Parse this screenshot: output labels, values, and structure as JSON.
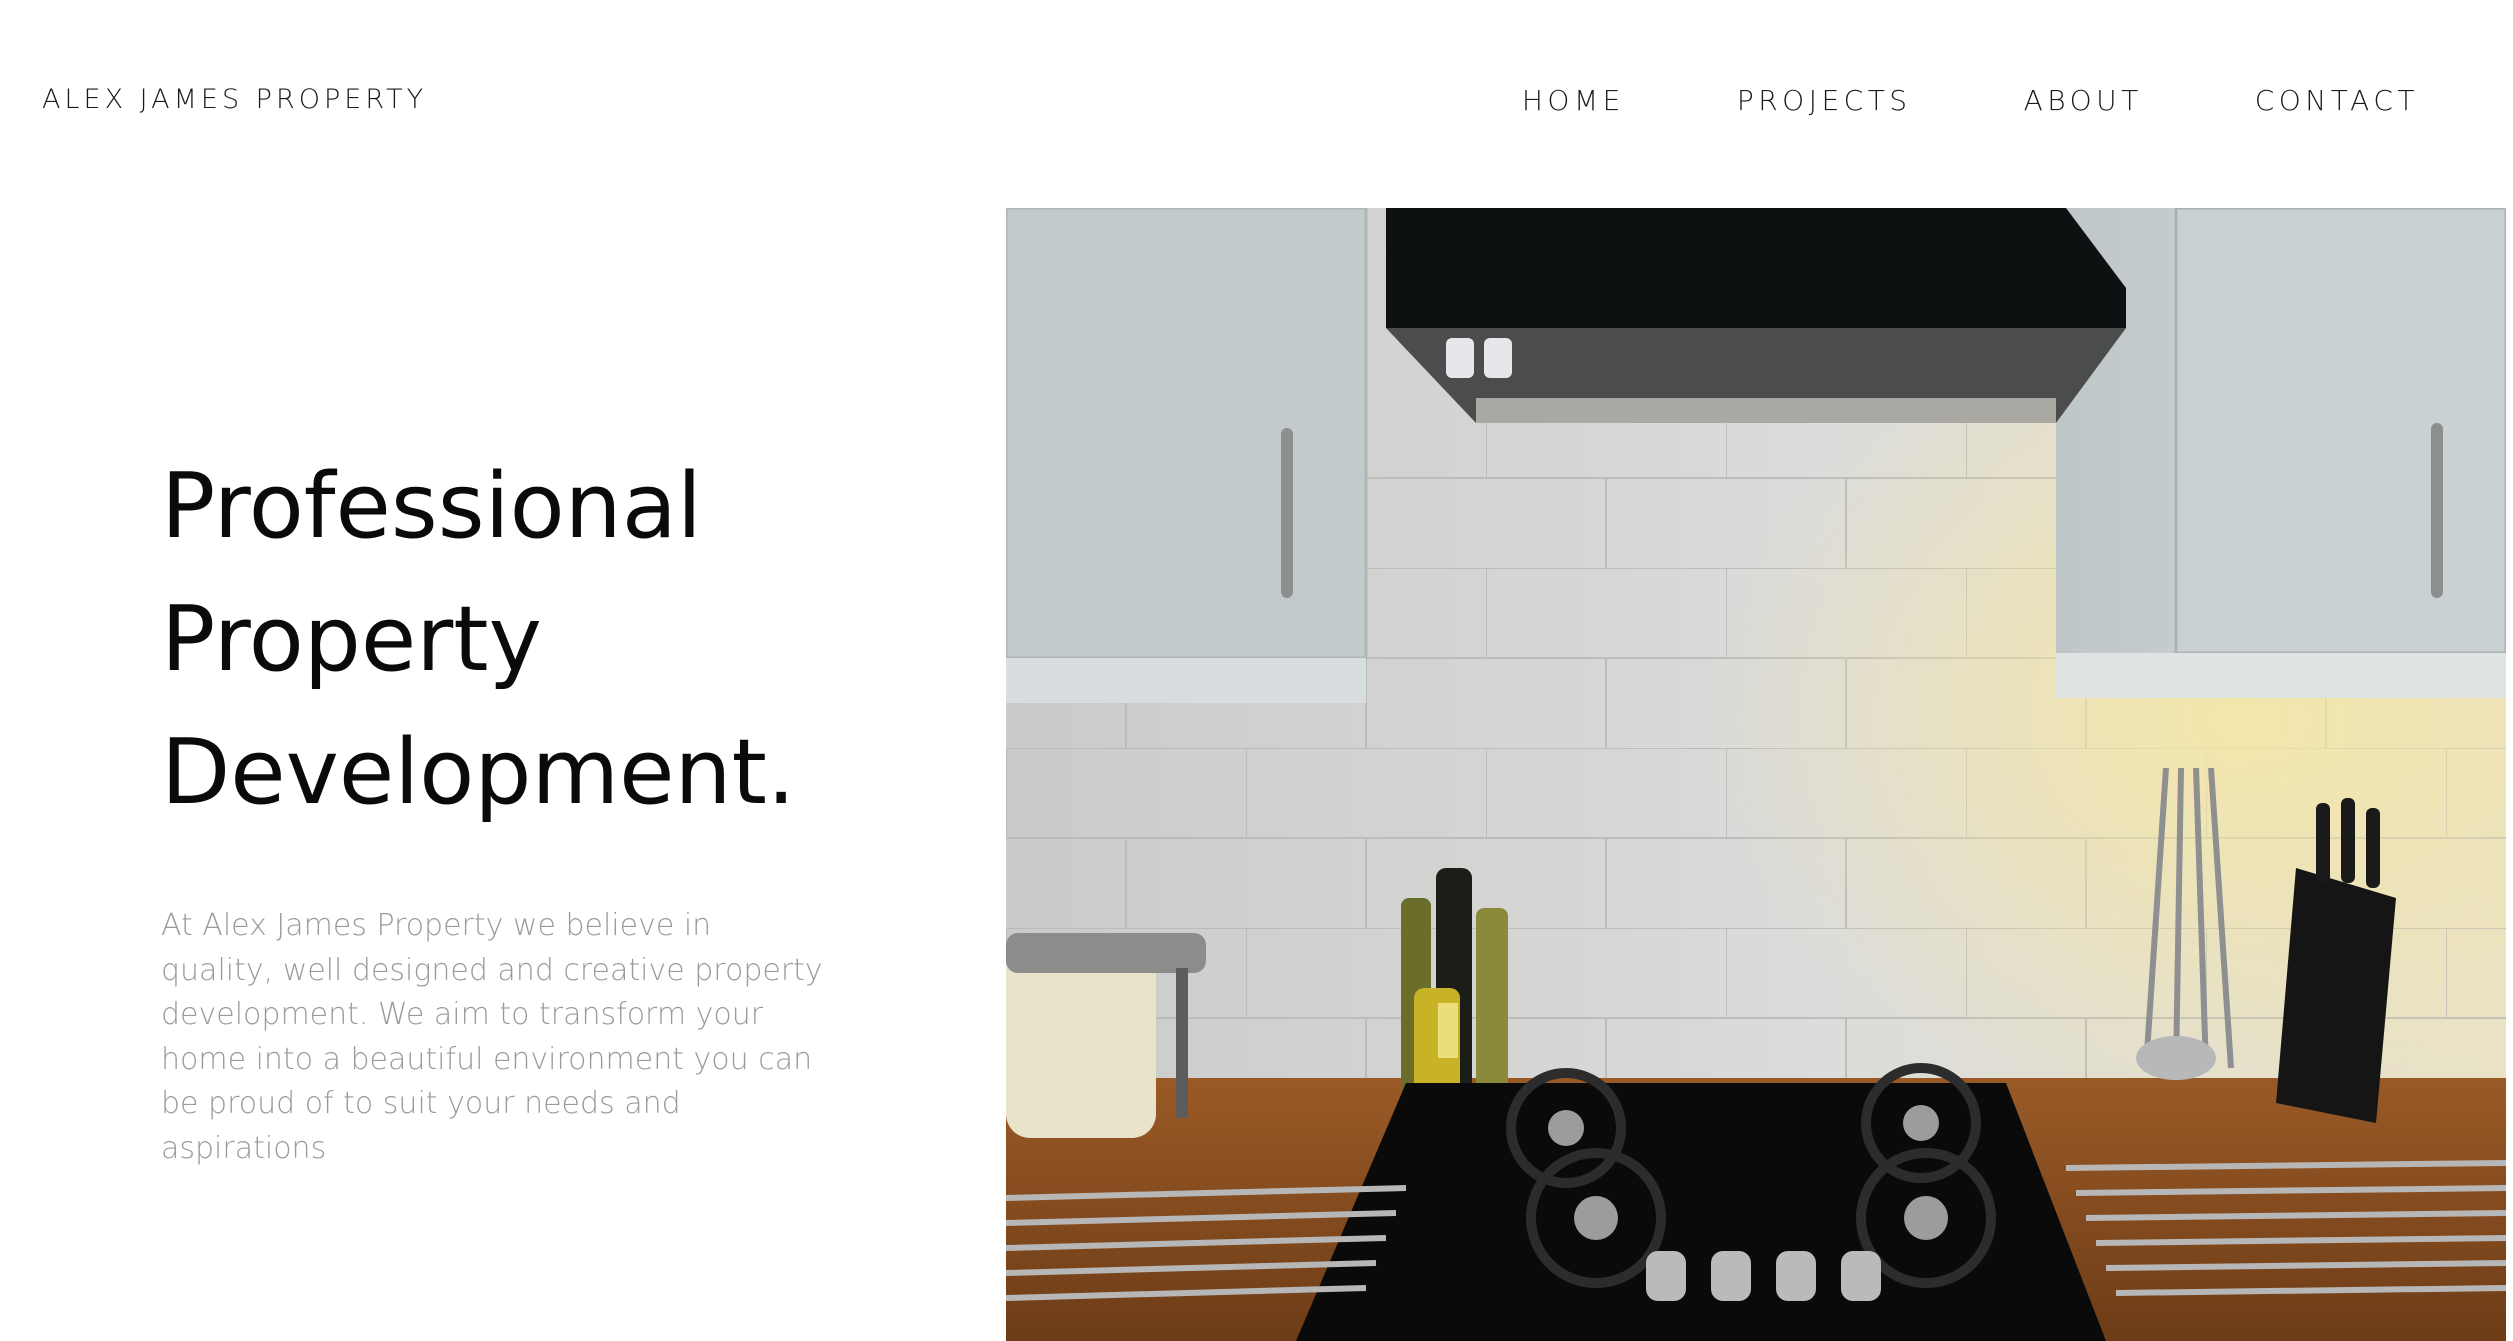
{
  "header": {
    "brand": "ALEX JAMES PROPERTY",
    "nav": [
      {
        "label": "HOME"
      },
      {
        "label": "PROJECTS"
      },
      {
        "label": "ABOUT"
      },
      {
        "label": "CONTACT"
      }
    ]
  },
  "hero": {
    "title_lines": [
      "Professional",
      "Property",
      "Development."
    ],
    "description": "At Alex James Property we believe in quality, well designed and creative property development. We aim to transform your home into a beautiful environment you can be proud of to suit your needs and aspirations",
    "image": {
      "subject": "kitchen-photo",
      "colors": {
        "wall": "#d9dad8",
        "cabinet": "#c9d2d4",
        "hood": "#0e1112",
        "counter": "#8a4f22",
        "hob": "#0a0a0a",
        "warm_light": "#f3e6a6"
      }
    }
  }
}
